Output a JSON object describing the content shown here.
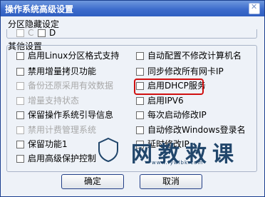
{
  "window": {
    "title": "操作系统高级设置"
  },
  "partition": {
    "title": "分区隐藏设定",
    "options": [
      {
        "label": "C",
        "checked": false,
        "disabled": true
      },
      {
        "label": "D",
        "checked": false,
        "disabled": false
      }
    ]
  },
  "other": {
    "title": "其他设置",
    "left": [
      {
        "label": "启用Linux分区格式支持",
        "checked": false,
        "disabled": false
      },
      {
        "label": "禁用增量拷贝功能",
        "checked": false,
        "disabled": false
      },
      {
        "label": "备份还原采用有效数据",
        "checked": false,
        "disabled": true
      },
      {
        "label": "增量支持状态",
        "checked": false,
        "disabled": true
      },
      {
        "label": "保留操作系统引导信息",
        "checked": false,
        "disabled": false
      },
      {
        "label": "禁用计费管理系统",
        "checked": false,
        "disabled": true
      },
      {
        "label": "保留功能1",
        "checked": false,
        "disabled": false
      },
      {
        "label": "启用高级保护控制",
        "checked": false,
        "disabled": false
      }
    ],
    "right": [
      {
        "label": "自动配置不修改计算机名",
        "checked": false,
        "disabled": false
      },
      {
        "label": "同步修改所有网卡IP",
        "checked": false,
        "disabled": false
      },
      {
        "label": "启用DHCP服务",
        "checked": false,
        "disabled": false
      },
      {
        "label": "启用IPV6",
        "checked": false,
        "disabled": false
      },
      {
        "label": "每次启动修改IP",
        "checked": false,
        "disabled": false
      },
      {
        "label": "自动修改Windows登录名",
        "checked": false,
        "disabled": false
      },
      {
        "label": "延时修改IP",
        "checked": false,
        "disabled": false
      }
    ]
  },
  "buttons": {
    "ok": "确定",
    "cancel": "取消"
  },
  "watermark": {
    "text": "网教救课",
    "url": "www.lywlbk.com"
  }
}
